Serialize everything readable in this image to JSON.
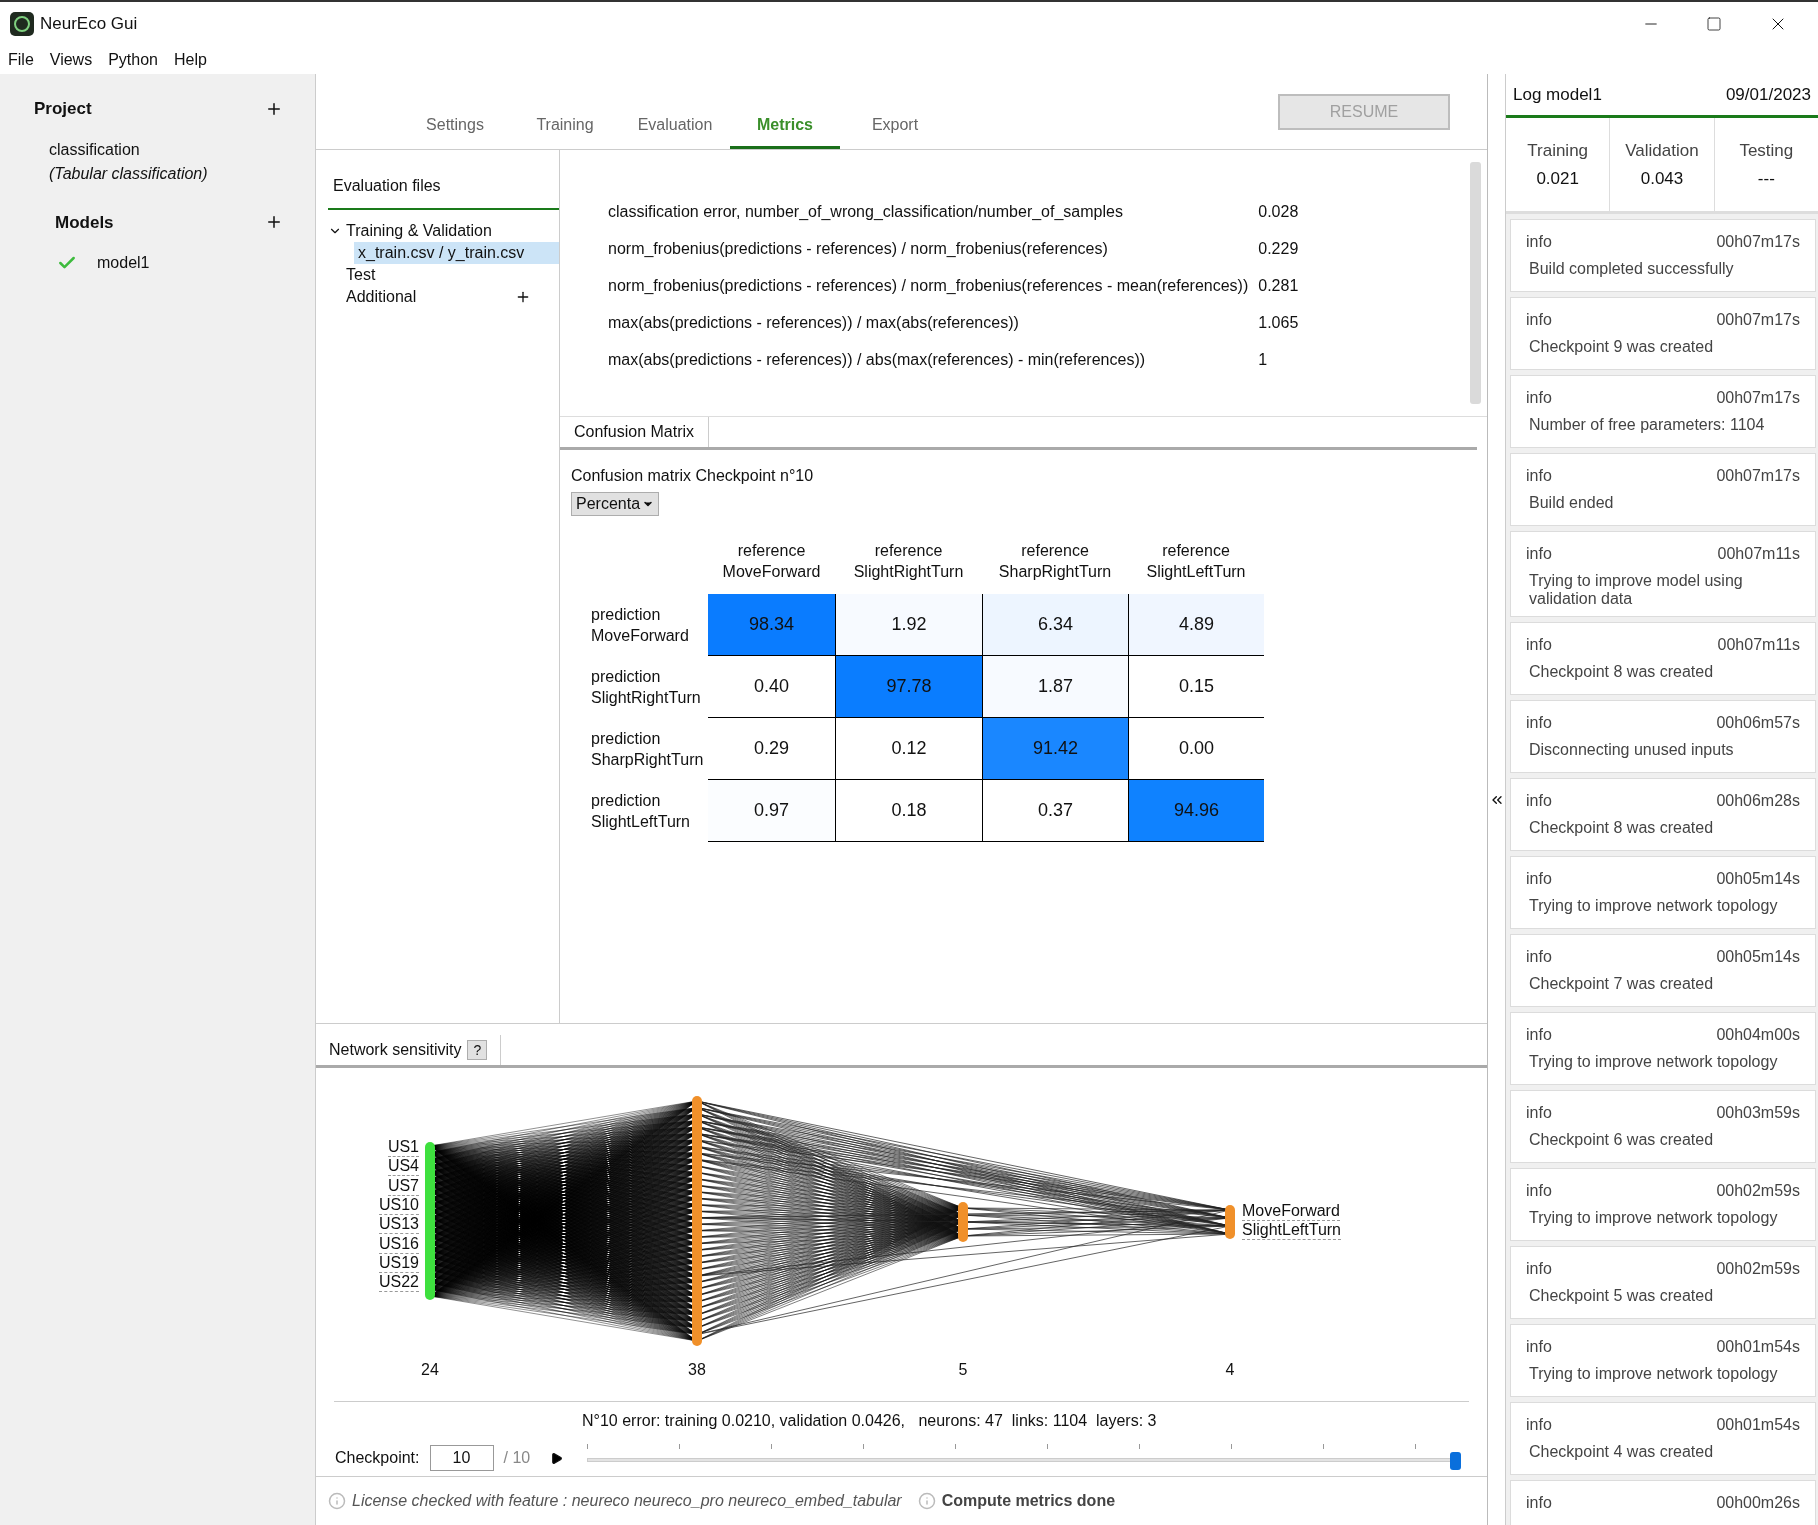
{
  "window": {
    "title": "NeurEco Gui"
  },
  "menu": [
    "File",
    "Views",
    "Python",
    "Help"
  ],
  "sidebar": {
    "project": {
      "label": "Project",
      "name": "classification",
      "type": "(Tabular classification)"
    },
    "models": {
      "label": "Models",
      "items": [
        {
          "name": "model1",
          "ok": true
        }
      ]
    }
  },
  "tabs": [
    {
      "label": "Settings",
      "selected": false
    },
    {
      "label": "Training",
      "selected": false
    },
    {
      "label": "Evaluation",
      "selected": false
    },
    {
      "label": "Metrics",
      "selected": true
    },
    {
      "label": "Export",
      "selected": false
    }
  ],
  "resume": {
    "label": "RESUME",
    "disabled": true
  },
  "eval_files": {
    "title": "Evaluation files",
    "tree": [
      {
        "label": "Training & Validation",
        "selected": false,
        "expanded": true,
        "children": [
          {
            "label": "x_train.csv / y_train.csv",
            "selected": true
          }
        ]
      },
      {
        "label": "Test",
        "selected": false
      },
      {
        "label": "Additional",
        "selected": false,
        "addable": true
      }
    ]
  },
  "metrics": [
    {
      "name": "classification error, number_of_wrong_classification/number_of_samples",
      "value": "0.028"
    },
    {
      "name": "norm_frobenius(predictions - references) / norm_frobenius(references)",
      "value": "0.229"
    },
    {
      "name": "norm_frobenius(predictions - references) / norm_frobenius(references - mean(references))",
      "value": "0.281"
    },
    {
      "name": "max(abs(predictions - references)) / max(abs(references))",
      "value": "1.065"
    },
    {
      "name": "max(abs(predictions - references)) / abs(max(references) - min(references))",
      "value": "1"
    }
  ],
  "confusion": {
    "tab": "Confusion Matrix",
    "title": "Confusion matrix Checkpoint n°10",
    "mode": "Percenta",
    "columns": [
      "reference MoveForward",
      "reference SlightRightTurn",
      "reference SharpRightTurn",
      "reference SlightLeftTurn"
    ],
    "rows": [
      {
        "label": "prediction MoveForward",
        "cells": [
          {
            "value": "98.34",
            "color": "#0a7cff"
          },
          {
            "value": "1.92",
            "color": "#f7faff"
          },
          {
            "value": "6.34",
            "color": "#edf5ff"
          },
          {
            "value": "4.89",
            "color": "#f0f6ff"
          }
        ]
      },
      {
        "label": "prediction SlightRightTurn",
        "cells": [
          {
            "value": "0.40",
            "color": "#ffffff"
          },
          {
            "value": "97.78",
            "color": "#0a7dff"
          },
          {
            "value": "1.87",
            "color": "#f7faff"
          },
          {
            "value": "0.15",
            "color": "#ffffff"
          }
        ]
      },
      {
        "label": "prediction SharpRightTurn",
        "cells": [
          {
            "value": "0.29",
            "color": "#ffffff"
          },
          {
            "value": "0.12",
            "color": "#ffffff"
          },
          {
            "value": "91.42",
            "color": "#1a87ff"
          },
          {
            "value": "0.00",
            "color": "#ffffff"
          }
        ]
      },
      {
        "label": "prediction SlightLeftTurn",
        "cells": [
          {
            "value": "0.97",
            "color": "#fbfdff"
          },
          {
            "value": "0.18",
            "color": "#ffffff"
          },
          {
            "value": "0.37",
            "color": "#ffffff"
          },
          {
            "value": "94.96",
            "color": "#0f82ff"
          }
        ]
      }
    ]
  },
  "network": {
    "title": "Network sensitivity",
    "help": "?",
    "inputs": [
      "US1",
      "US4",
      "US7",
      "US10",
      "US13",
      "US16",
      "US19",
      "US22"
    ],
    "outputs": [
      "MoveForward",
      "SlightLeftTurn"
    ],
    "layer_sizes": [
      "24",
      "38",
      "5",
      "4"
    ],
    "summary": "N°10 error: training 0.0210, validation 0.0426,   neurons: 47  links: 1104  layers: 3",
    "checkpoint": {
      "label": "Checkpoint:",
      "value": "10",
      "total": "/ 10",
      "level": 1
    }
  },
  "status": {
    "license": "License checked with feature : neureco neureco_pro neureco_embed_tabular",
    "message": "Compute metrics done"
  },
  "log": {
    "title": "Log model1",
    "date": "09/01/2023",
    "stats": [
      {
        "label": "Training",
        "value": "0.021"
      },
      {
        "label": "Validation",
        "value": "0.043"
      },
      {
        "label": "Testing",
        "value": "---"
      }
    ],
    "entries": [
      {
        "level": "info",
        "time": "00h07m17s",
        "message": "Build completed successfully"
      },
      {
        "level": "info",
        "time": "00h07m17s",
        "message": "Checkpoint 9 was created"
      },
      {
        "level": "info",
        "time": "00h07m17s",
        "message": "Number of free parameters: 1104"
      },
      {
        "level": "info",
        "time": "00h07m17s",
        "message": "Build ended"
      },
      {
        "level": "info",
        "time": "00h07m11s",
        "message": "Trying to improve model using validation data"
      },
      {
        "level": "info",
        "time": "00h07m11s",
        "message": "Checkpoint 8 was created"
      },
      {
        "level": "info",
        "time": "00h06m57s",
        "message": "Disconnecting unused inputs"
      },
      {
        "level": "info",
        "time": "00h06m28s",
        "message": "Checkpoint 8 was created"
      },
      {
        "level": "info",
        "time": "00h05m14s",
        "message": "Trying to improve network topology"
      },
      {
        "level": "info",
        "time": "00h05m14s",
        "message": "Checkpoint 7 was created"
      },
      {
        "level": "info",
        "time": "00h04m00s",
        "message": "Trying to improve network topology"
      },
      {
        "level": "info",
        "time": "00h03m59s",
        "message": "Checkpoint 6 was created"
      },
      {
        "level": "info",
        "time": "00h02m59s",
        "message": "Trying to improve network topology"
      },
      {
        "level": "info",
        "time": "00h02m59s",
        "message": "Checkpoint 5 was created"
      },
      {
        "level": "info",
        "time": "00h01m54s",
        "message": "Trying to improve network topology"
      },
      {
        "level": "info",
        "time": "00h01m54s",
        "message": "Checkpoint 4 was created"
      },
      {
        "level": "info",
        "time": "00h00m26s"
      }
    ]
  }
}
